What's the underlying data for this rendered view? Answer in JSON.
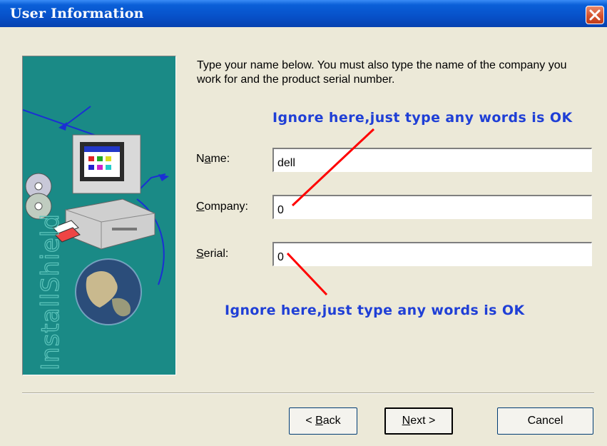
{
  "window": {
    "title": "User Information"
  },
  "icons": {
    "close": "close-icon",
    "logo": "installshield-logo"
  },
  "side_panel": {
    "brand_text": "InstallShield"
  },
  "instruction": "Type your name below. You must also type the name of the company you work for and the product serial number.",
  "fields": {
    "name": {
      "label_pre": "N",
      "label_mnemonic": "a",
      "label_post": "me:",
      "value": "dell"
    },
    "company": {
      "label_pre": "",
      "label_mnemonic": "C",
      "label_post": "ompany:",
      "value": "0"
    },
    "serial": {
      "label_pre": "",
      "label_mnemonic": "S",
      "label_post": "erial:",
      "value": "0"
    }
  },
  "annotations": {
    "top": "Ignore here,just type any words is OK",
    "bottom": "Ignore here,just type any words is OK",
    "arrow_color": "#ff0000",
    "text_color": "#1f3fd6"
  },
  "buttons": {
    "back": {
      "pre": "< ",
      "mnemonic": "B",
      "post": "ack"
    },
    "next": {
      "pre": "",
      "mnemonic": "N",
      "post": "ext >"
    },
    "cancel": {
      "label": "Cancel"
    }
  }
}
